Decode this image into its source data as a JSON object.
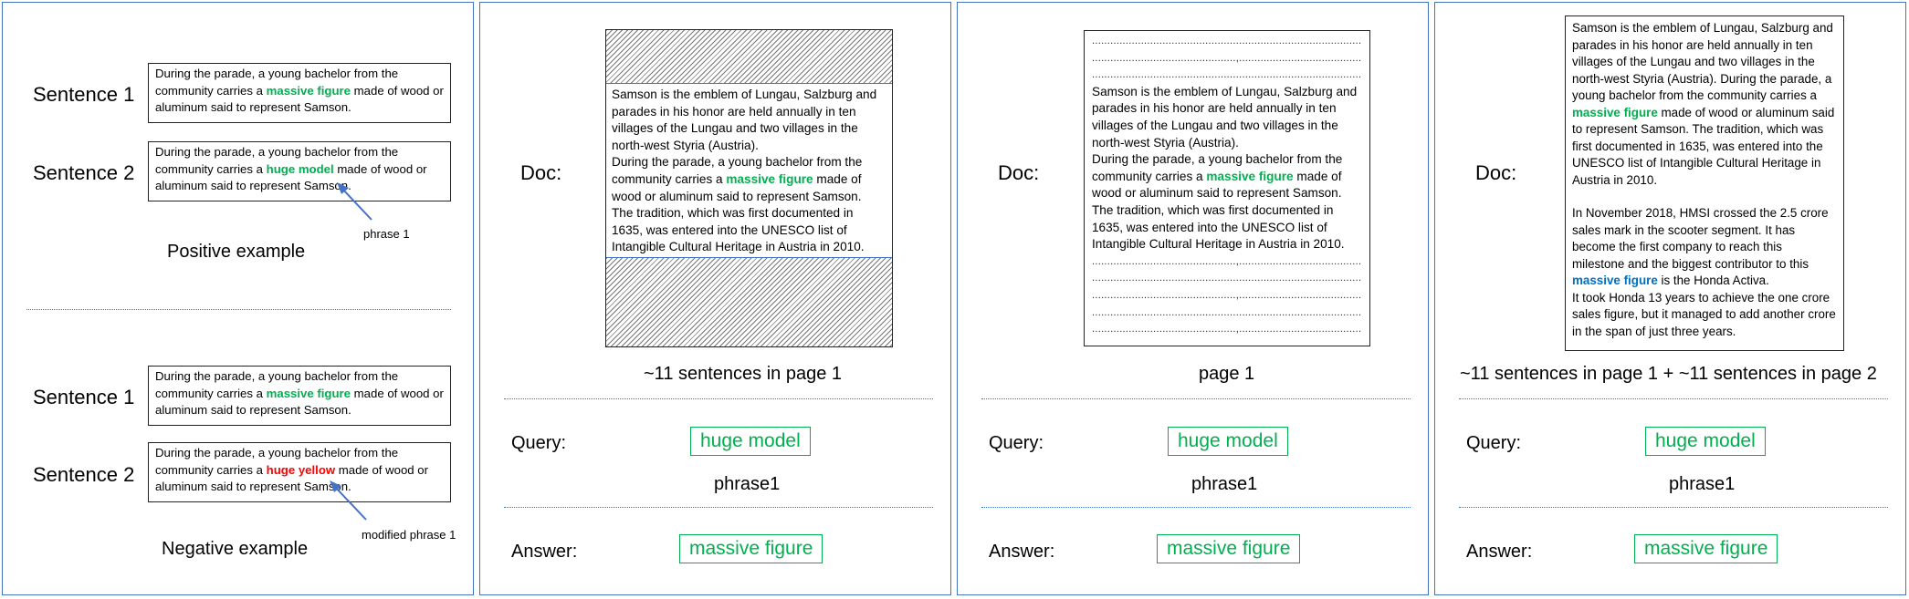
{
  "panel1": {
    "positive": {
      "sentence1_label": "Sentence 1",
      "sentence2_label": "Sentence 2",
      "s1": {
        "pre": "During the parade, a young bachelor from the community carries a ",
        "phrase": "massive figure",
        "post": " made of wood or aluminum said to represent Samson."
      },
      "s2": {
        "pre": "During the parade, a young bachelor from the community carries a ",
        "phrase": "huge model",
        "post": " made of wood or aluminum said to represent Samson."
      },
      "arrow_label": "phrase 1",
      "caption": "Positive example"
    },
    "negative": {
      "sentence1_label": "Sentence 1",
      "sentence2_label": "Sentence 2",
      "s1": {
        "pre": "During the parade, a young bachelor from the community carries a ",
        "phrase": "massive figure",
        "post": " made of wood or aluminum said to represent Samson."
      },
      "s2": {
        "pre": "During the parade, a young bachelor from the community carries a ",
        "phrase": "huge yellow",
        "post": " made of wood or aluminum said to represent Samson."
      },
      "arrow_label": "modified phrase 1",
      "caption": "Negative example"
    }
  },
  "panel2": {
    "doc_label": "Doc:",
    "doc": {
      "l1": "Samson is the emblem of Lungau, Salzburg and parades in his honor are held annually in ten villages of the Lungau and two villages in the north-west Styria (Austria).",
      "l2_pre": "During the parade, a young bachelor from the community carries a ",
      "l2_phrase": "massive figure",
      "l2_post": " made of wood or aluminum said to represent Samson.",
      "l3": "The tradition, which was first documented in 1635, was entered into the UNESCO list of Intangible Cultural Heritage in Austria in 2010."
    },
    "caption": "~11 sentences in page 1",
    "query_label": "Query:",
    "query": "huge model",
    "query_sub": "phrase1",
    "answer_label": "Answer:",
    "answer": "massive figure"
  },
  "panel3": {
    "doc_label": "Doc:",
    "dots_long": "..........................................................................................................",
    "dots_mixed": "...............................................,..........................................................",
    "doc": {
      "l1": "Samson is the emblem of Lungau, Salzburg and parades in his honor are held annually in ten villages of the Lungau and two villages in the north-west Styria (Austria).",
      "l2_pre": "During the parade, a young bachelor from the community carries a ",
      "l2_phrase": "massive figure",
      "l2_post": " made of wood or aluminum said to represent Samson.",
      "l3": "The tradition, which was first documented in 1635, was entered into the UNESCO list of Intangible Cultural Heritage in Austria in 2010."
    },
    "caption": "page 1",
    "query_label": "Query:",
    "query": "huge model",
    "query_sub": "phrase1",
    "answer_label": "Answer:",
    "answer": "massive figure"
  },
  "panel4": {
    "doc_label": "Doc:",
    "doc": {
      "p1_pre": "Samson is the emblem of Lungau, Salzburg and parades in his honor are held annually in ten villages of the Lungau and two villages in the north-west Styria (Austria). During the parade, a young bachelor from the community carries a ",
      "p1_phrase": "massive figure",
      "p1_post": " made of wood or aluminum said to represent Samson. The tradition, which was first documented in 1635, was entered into the UNESCO list of Intangible Cultural Heritage in Austria in 2010.",
      "p2_pre": "In November 2018, HMSI crossed the 2.5 crore sales mark in the scooter segment. It has become the first company to reach this milestone and the biggest contributor to this ",
      "p2_phrase": "massive figure",
      "p2_post": " is the Honda Activa.",
      "p3": "It took Honda 13 years to achieve the one crore sales figure, but it managed to add another crore in the span of just three years."
    },
    "caption": "~11 sentences in page 1 + ~11 sentences in page 2",
    "query_label": "Query:",
    "query": "huge model",
    "query_sub": "phrase1",
    "answer_label": "Answer:",
    "answer": "massive figure"
  }
}
